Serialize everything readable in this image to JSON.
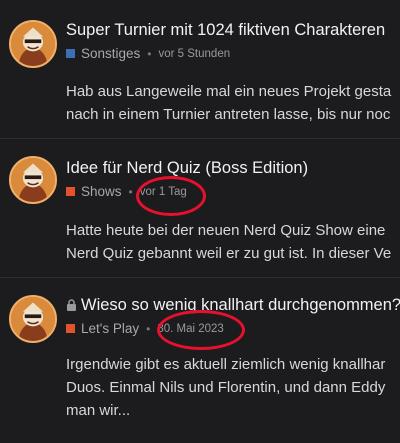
{
  "posts": [
    {
      "title": "Super Turnier mit 1024 fiktiven Charakteren",
      "category": "Sonstiges",
      "category_color": "#3d6fb5",
      "time": "vor 5 Stunden",
      "excerpt_lines": [
        "Hab aus Langeweile mal ein neues Projekt gesta",
        "nach in einem Turnier antreten lasse, bis nur noc"
      ],
      "locked": false
    },
    {
      "title": "Idee für Nerd Quiz (Boss Edition)",
      "category": "Shows",
      "category_color": "#e4522b",
      "time": "vor 1 Tag",
      "excerpt_lines": [
        "Hatte heute bei der neuen Nerd Quiz Show eine",
        "Nerd Quiz gebannt weil er zu gut ist. In dieser Ve"
      ],
      "locked": false
    },
    {
      "title": "Wieso so wenig knallhart durchgenommen?",
      "category": "Let's Play",
      "category_color": "#e4522b",
      "time": "30. Mai 2023",
      "excerpt_lines": [
        "Irgendwie gibt es aktuell ziemlich wenig knallhar",
        "Duos. Einmal Nils und Florentin, und dann Eddy",
        "man wir..."
      ],
      "locked": true,
      "lock_icon": "lock-icon"
    }
  ],
  "annotation_color": "#e8112d"
}
